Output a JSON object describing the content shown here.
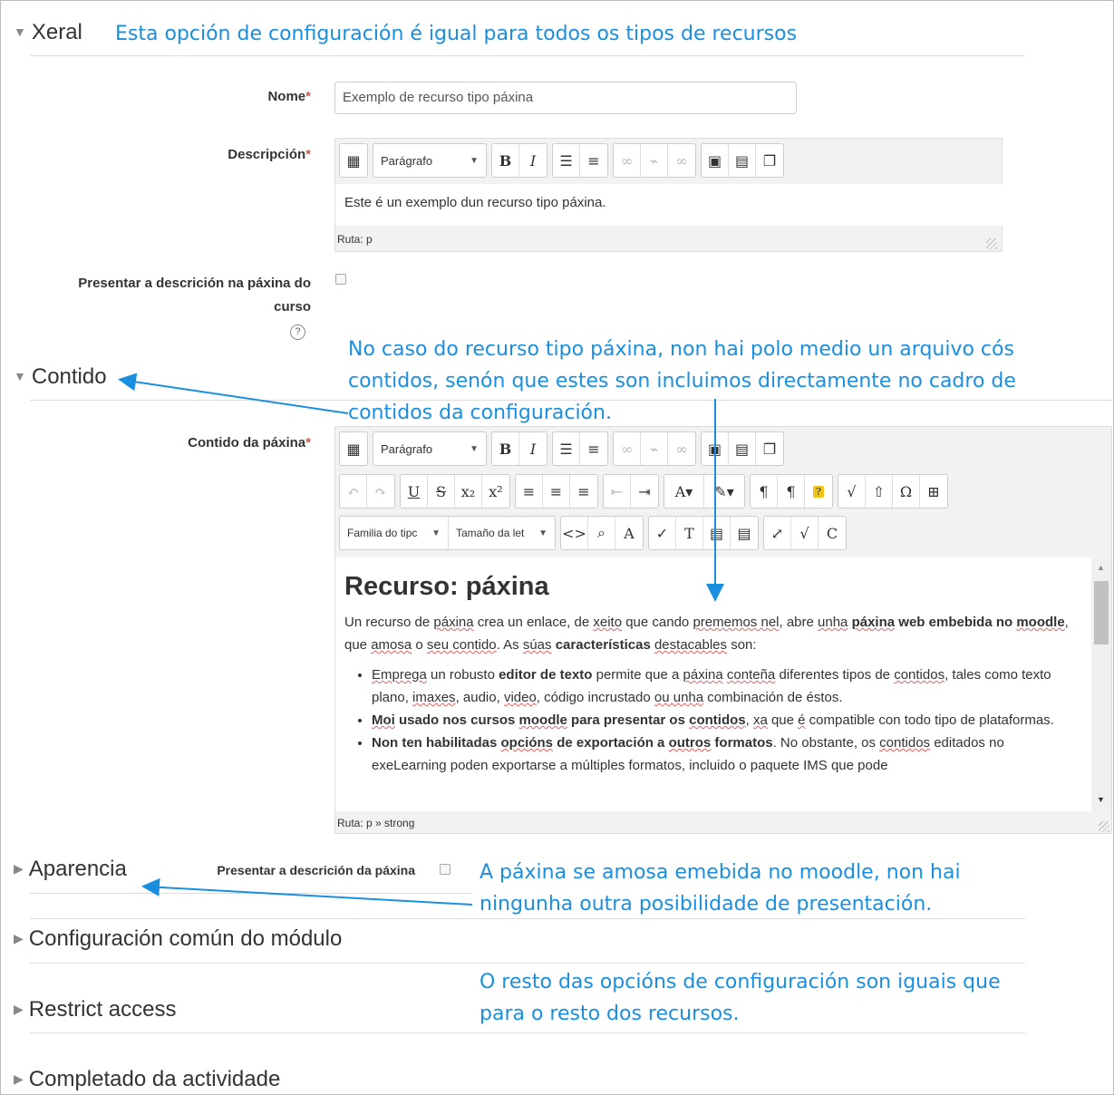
{
  "sections": {
    "xeral": "Xeral",
    "contido": "Contido",
    "aparencia": "Aparencia",
    "configuracion": "Configuración común do módulo",
    "restrict": "Restrict access",
    "completado": "Completado da actividade"
  },
  "notes": {
    "xeral": "Esta opción de configuración é igual para todos os tipos de recursos",
    "contido_1": "No caso do recurso tipo páxina, non hai polo medio un arquivo cós",
    "contido_2": "contidos, senón que estes son incluimos directamente no cadro de",
    "contido_3": "contidos da configuración.",
    "aparencia_1": "A páxina se amosa emebida no moodle, non hai",
    "aparencia_2": "ningunha outra posibilidade de presentación.",
    "resto_1": "O resto das opcións de configuración son iguais que",
    "resto_2": "para o resto dos recursos."
  },
  "form": {
    "nome_label": "Nome",
    "nome_value": "Exemplo de recurso tipo páxina",
    "descripcion_label": "Descripción",
    "required_mark": "*",
    "descripcion_text": "Este é un exemplo dun recurso tipo páxina.",
    "descripcion_path": "Ruta: p",
    "presentar_label_1": "Presentar a descrición na páxina do",
    "presentar_label_2": "curso",
    "help_icon": "?",
    "contido_label": "Contido da páxina",
    "contido_path": "Ruta: p » strong",
    "aparencia_label": "Presentar a descrición da páxina"
  },
  "toolbar": {
    "paragraph": "Parágrafo",
    "font_family": "Familia do tipc",
    "font_size": "Tamaño da let"
  },
  "doc": {
    "heading": "Recurso: páxina",
    "p1_a": "Un recurso de ",
    "p1_b": "páxina",
    "p1_c": " crea un enlace, de ",
    "p1_d": "xeito",
    "p1_e": " que cando ",
    "p1_f": "prememos nel",
    "p1_g": ", abre ",
    "p1_h": "unha",
    "p1_i": "páxina",
    "p1_j": "web",
    "p1_k": "embebida no",
    "p1_l": "moodle",
    "p1_m": ", que ",
    "p1_n": "amosa",
    "p1_o": " o ",
    "p1_p": "seu contido",
    "p1_q": ". As ",
    "p1_r": "súas",
    "p1_s": "características",
    "p1_t": "destacables",
    "p1_u": " son:",
    "li1_a": "Emprega",
    "li1_b": " un robusto ",
    "li1_c": "editor de texto",
    "li1_d": " permite que a ",
    "li1_e": "páxina",
    "li1_f": "conteña",
    "li1_g": " diferentes tipos de ",
    "li1_h": "contidos",
    "li1_i": ", tales como texto plano, ",
    "li1_j": "imaxes",
    "li1_k": ", audio, ",
    "li1_l": "video",
    "li1_m": ", código incrustado ",
    "li1_n": "ou unha",
    "li1_o": " combinación de éstos.",
    "li2_a": "Moi",
    "li2_b": " usado nos cursos ",
    "li2_c": "moodle",
    "li2_d": " para presentar os ",
    "li2_e": "contidos",
    "li2_f": ", ",
    "li2_g": "xa",
    "li2_h": " que ",
    "li2_i": "é",
    "li2_j": " compatible con todo tipo de plataformas.",
    "li3_a": "Non ten habilitadas ",
    "li3_b": "opcións",
    "li3_c": " de exportación a ",
    "li3_d": "outros",
    "li3_e": " formatos",
    "li3_f": ". No obstante, os ",
    "li3_g": "contidos",
    "li3_h": "editados no exeLearning poden exportarse a múltiples formatos, incluido o paquete IMS que pode"
  },
  "colors": {
    "annotation": "#1a8fe0",
    "required": "#d9534f"
  }
}
